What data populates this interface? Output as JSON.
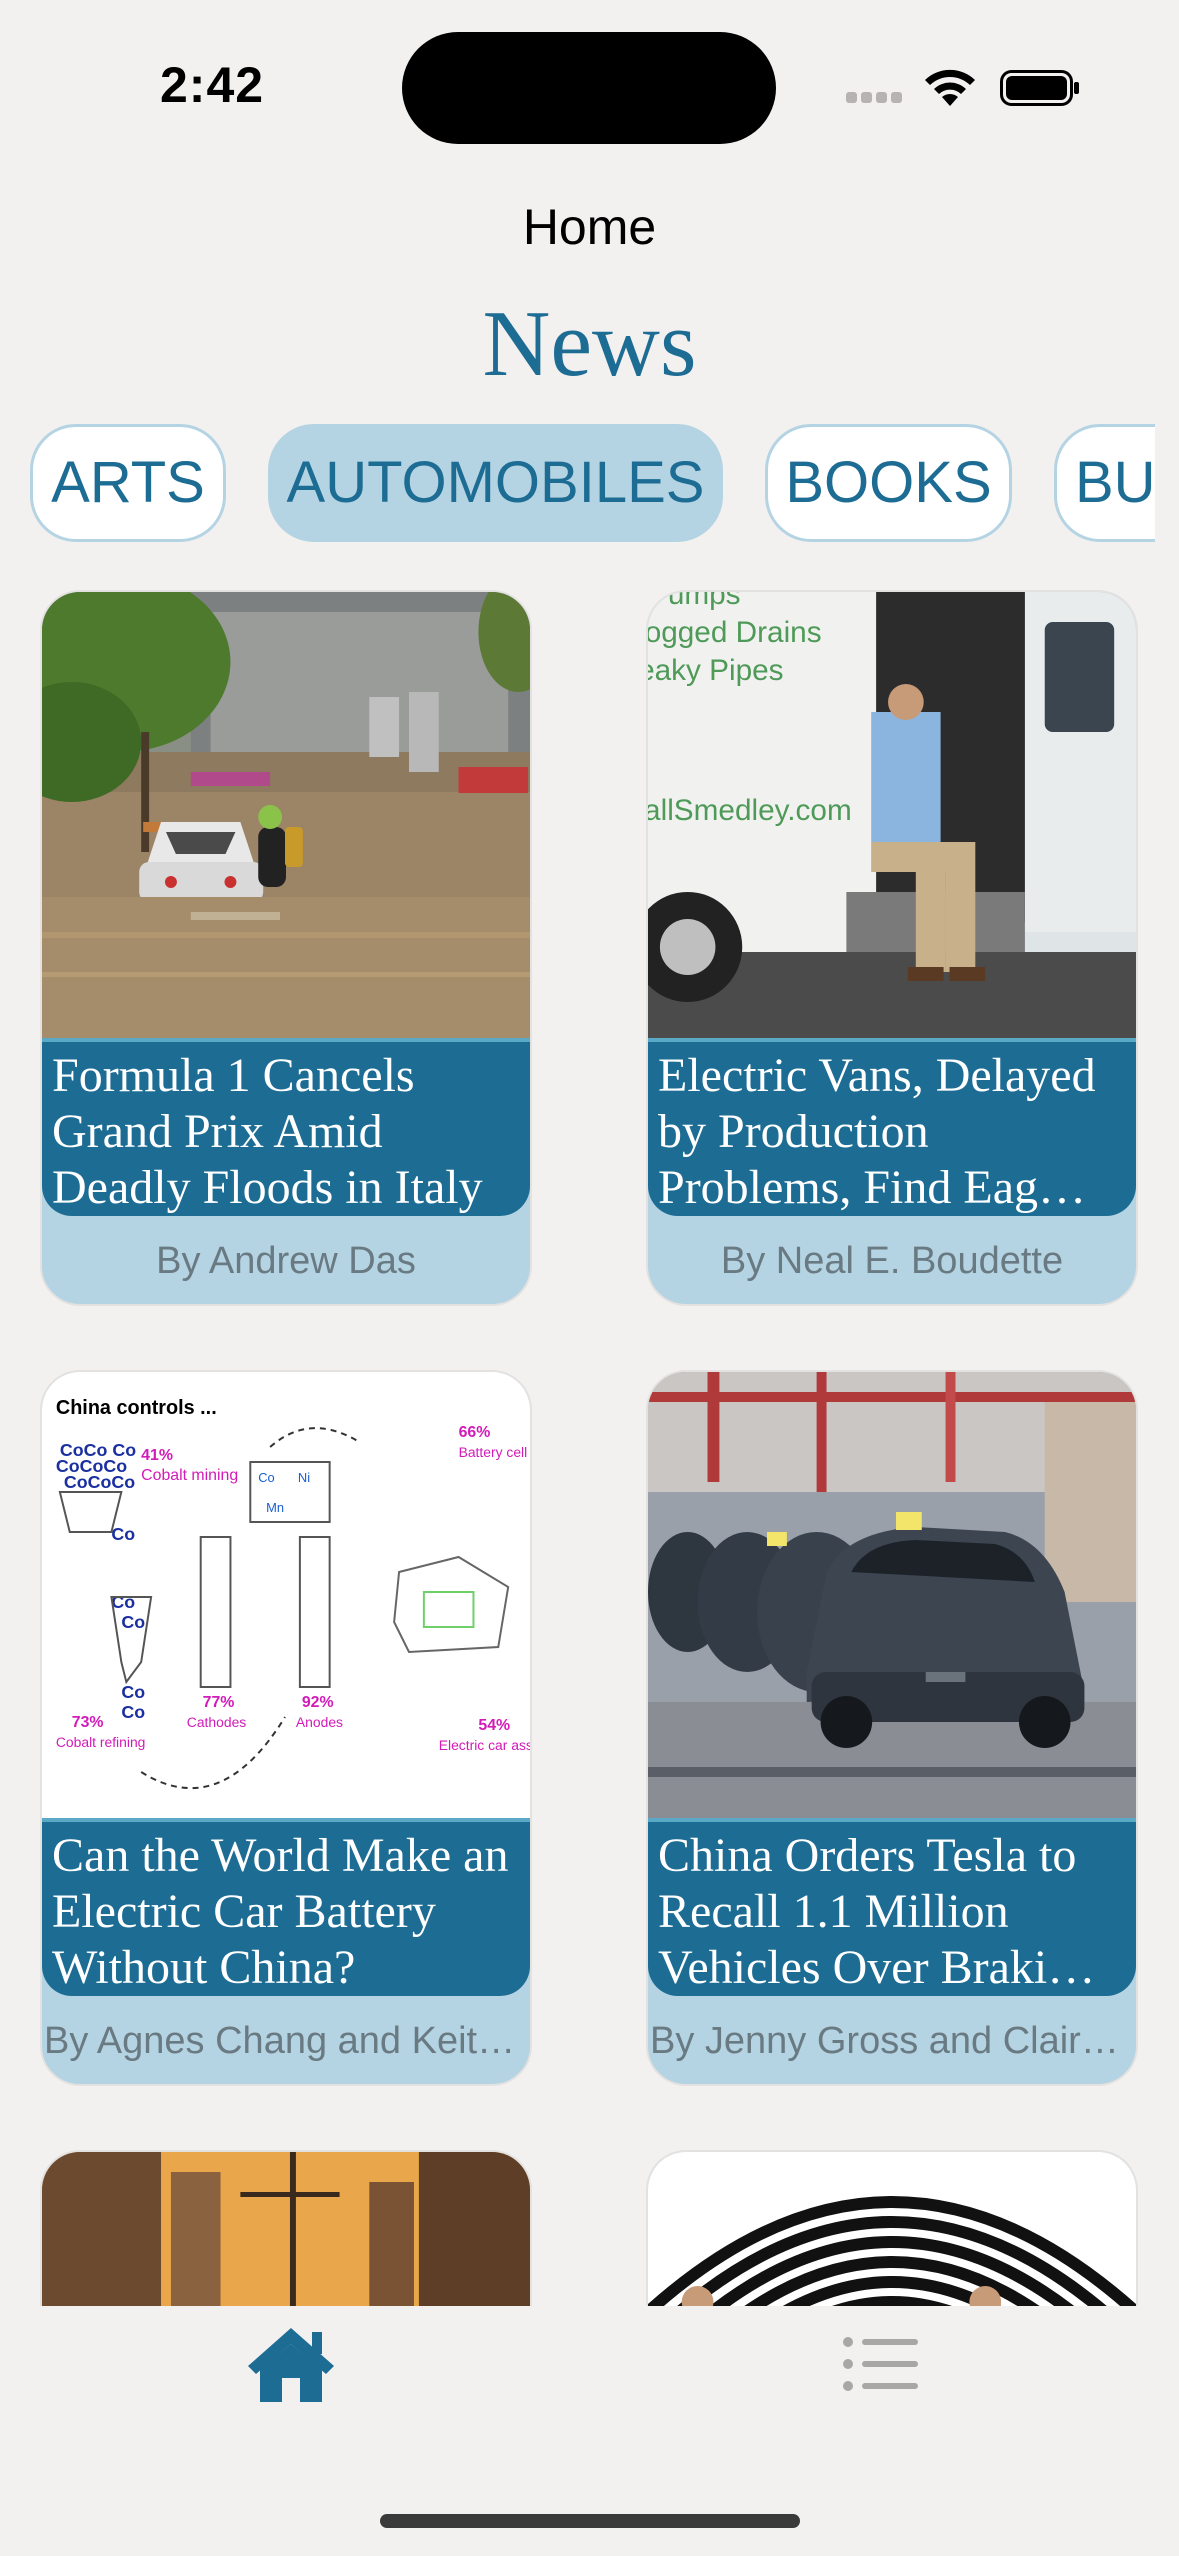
{
  "status_bar": {
    "time": "2:42"
  },
  "header": {
    "nav_title": "Home",
    "brand": "News"
  },
  "categories": [
    {
      "label": "ARTS",
      "selected": false
    },
    {
      "label": "AUTOMOBILES",
      "selected": true
    },
    {
      "label": "BOOKS",
      "selected": false
    },
    {
      "label": "BU",
      "selected": false
    }
  ],
  "articles": [
    {
      "title": "Formula 1 Cancels Grand Prix Amid Deadly Floods in Italy",
      "byline": "By Andrew Das"
    },
    {
      "title": "Electric Vans, Delayed by Production Problems, Find Eag…",
      "byline": "By Neal E. Boudette"
    },
    {
      "title": "Can the World Make an Electric Car Battery Without China?",
      "byline": "By Agnes Chang and Keit…"
    },
    {
      "title": "China Orders Tesla to Recall 1.1 Million Vehicles Over Braki…",
      "byline": "By Jenny Gross and Clair…"
    }
  ],
  "battery_infographic": {
    "heading": "China controls ...",
    "stats": [
      {
        "pct": "41%",
        "label": "Cobalt mining"
      },
      {
        "pct": "66%",
        "label": "Battery cell assembly"
      },
      {
        "pct": "73%",
        "label": "Cobalt refining"
      },
      {
        "pct": "77%",
        "label": "Cathodes"
      },
      {
        "pct": "92%",
        "label": "Anodes"
      },
      {
        "pct": "54%",
        "label": "Electric car assembly"
      }
    ]
  },
  "van_text": {
    "line1": "umps",
    "line2": "logged Drains",
    "line3": "eaky Pipes",
    "line4": "allSmedley.com"
  },
  "tabs": [
    {
      "name": "home",
      "icon": "house-icon",
      "selected": true
    },
    {
      "name": "list",
      "icon": "list-icon",
      "selected": false
    }
  ],
  "colors": {
    "accent": "#1d6c94",
    "chip_bg": "#b5d4e3",
    "background": "#f3f0f0"
  }
}
